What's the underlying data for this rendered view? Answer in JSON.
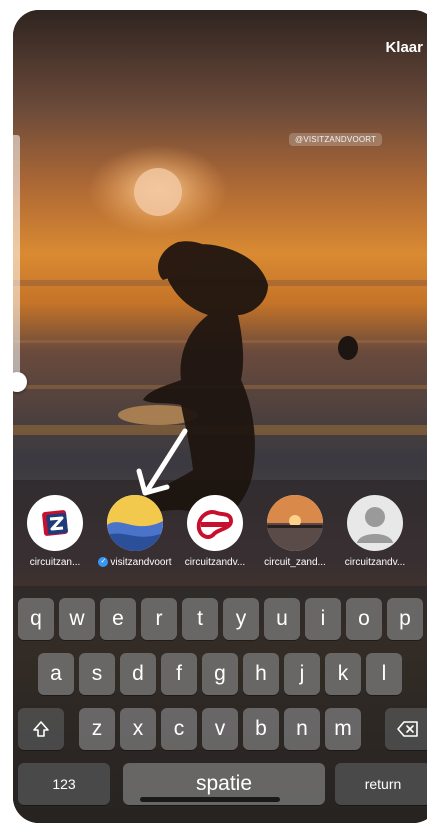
{
  "header": {
    "done_label": "Klaar"
  },
  "sticker": {
    "tag_label": "@VISITZANDVOORT"
  },
  "accounts": [
    {
      "label": "circuitzan...",
      "icon": "circuit-zandvoort-logo-icon"
    },
    {
      "label": "visitzandvoort",
      "verified": true,
      "icon": "visit-zandvoort-logo-icon"
    },
    {
      "label": "circuitzandv...",
      "icon": "zandvoort-circuit-logo-icon"
    },
    {
      "label": "circuit_zand...",
      "icon": "sunset-pier-photo-icon"
    },
    {
      "label": "circuitzandv...",
      "icon": "default-user-icon"
    }
  ],
  "keyboard": {
    "row1": [
      "q",
      "w",
      "e",
      "r",
      "t",
      "y",
      "u",
      "i",
      "o",
      "p"
    ],
    "row2": [
      "a",
      "s",
      "d",
      "f",
      "g",
      "h",
      "j",
      "k",
      "l"
    ],
    "row3": [
      "z",
      "x",
      "c",
      "v",
      "b",
      "n",
      "m"
    ],
    "numbers_label": "123",
    "space_label": "spatie",
    "return_label": "return",
    "shift_icon": "shift-icon",
    "delete_icon": "backspace-icon"
  },
  "colors": {
    "verified": "#3897f0",
    "sky_top": "#3a2a24",
    "sun_glow": "#e58a2b"
  }
}
